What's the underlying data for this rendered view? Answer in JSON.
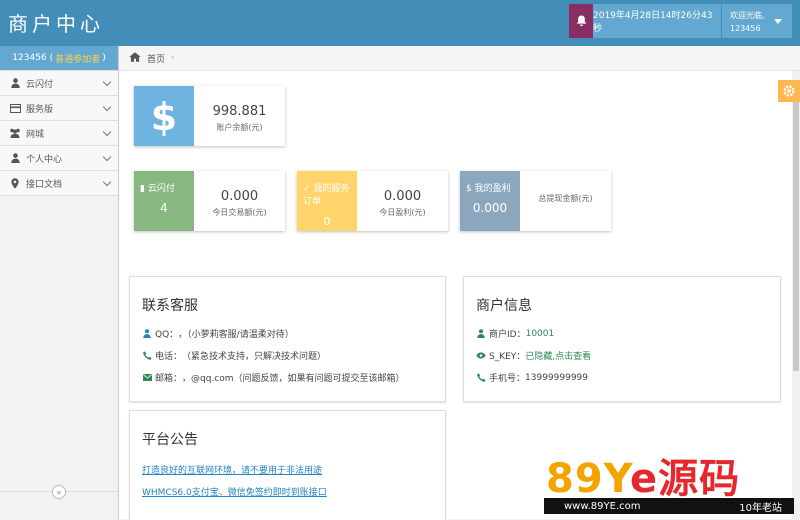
{
  "header": {
    "brand": "商户中心",
    "datetime": "2019年4月28日14时26分43秒",
    "welcome": "欢迎光临,",
    "username": "123456",
    "icons": {
      "notify": "bell-icon",
      "menu": "caret-down-icon"
    }
  },
  "sidebar": {
    "account_id": "123456",
    "account_level": "普通参加者",
    "items": [
      {
        "label": "云闪付",
        "icon": "user-icon"
      },
      {
        "label": "服务版",
        "icon": "card-icon"
      },
      {
        "label": "网城",
        "icon": "group-icon"
      },
      {
        "label": "个人中心",
        "icon": "user-icon"
      },
      {
        "label": "接口文档",
        "icon": "map-marker-icon"
      }
    ],
    "collapse": "«"
  },
  "breadcrumb": {
    "home": "首页"
  },
  "balance": {
    "value": "998.881",
    "label": "账户余额(元)",
    "icon": "dollar-icon",
    "color": "#6fb3e0"
  },
  "stats": [
    {
      "tile_title": "云闪付",
      "tile_value": "4",
      "value": "0.000",
      "label": "今日交易额(元)",
      "color": "#87b87f"
    },
    {
      "tile_title": "我的服务订单",
      "tile_value": "0",
      "value": "0.000",
      "label": "今日盈利(元)",
      "color": "#ffd46a"
    },
    {
      "tile_title": "我的盈利",
      "tile_value": "0.000",
      "value": "",
      "label": "总提现金额(元)",
      "color": "#8aa7bd"
    }
  ],
  "contact": {
    "title": "联系客服",
    "qq_label": "QQ：",
    "qq_value": "，（小萝莉客服/请温柔对待）",
    "phone_label": "电话：",
    "phone_value": "（紧急技术支持，只解决技术问题）",
    "email_label": "邮箱：",
    "email_value": "，@qq.com（问题反馈，如果有问题可提交至该邮箱）"
  },
  "merchant": {
    "title": "商户信息",
    "id_label": "商户ID：",
    "id_value": "10001",
    "key_label": "S_KEY：",
    "key_value": "已隐藏,点击查看",
    "mobile_label": "手机号：",
    "mobile_value": "13999999999"
  },
  "notice": {
    "title": "平台公告",
    "links": [
      "打造良好的互联网环境，请不要用于非法用途",
      "WHMCS6.0支付宝、微信免签约即时到账接口"
    ]
  },
  "watermark": {
    "logo_a": "89Y",
    "logo_b": "e源码",
    "url": "www.89YE.com",
    "slogan": "10年老站"
  }
}
